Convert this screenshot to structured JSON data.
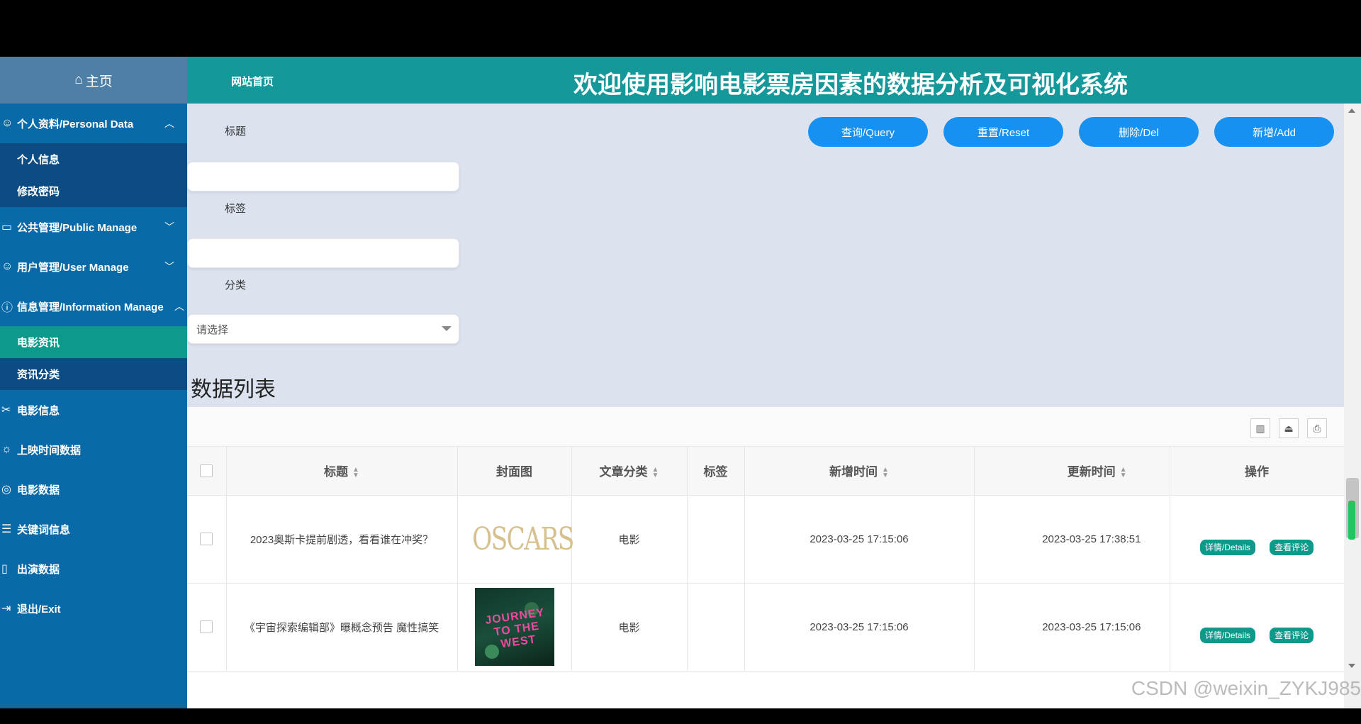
{
  "sidebar": {
    "home": "主页",
    "groups": [
      {
        "label": "个人资料/Personal Data",
        "icon": "user-icon",
        "expanded": true,
        "items": [
          "个人信息",
          "修改密码"
        ]
      },
      {
        "label": "公共管理/Public Manage",
        "icon": "monitor-icon",
        "expanded": false,
        "items": []
      },
      {
        "label": "用户管理/User Manage",
        "icon": "user-icon",
        "expanded": false,
        "items": []
      },
      {
        "label": "信息管理/Information Manage",
        "icon": "info-icon",
        "expanded": true,
        "items": [
          "电影资讯",
          "资讯分类"
        ],
        "active_item": "电影资讯"
      },
      {
        "label": "电影信息",
        "icon": "film-icon"
      },
      {
        "label": "上映时间数据",
        "icon": "calendar-icon"
      },
      {
        "label": "电影数据",
        "icon": "data-icon"
      },
      {
        "label": "关键词信息",
        "icon": "keyword-icon"
      },
      {
        "label": "出演数据",
        "icon": "phone-icon"
      },
      {
        "label": "退出/Exit",
        "icon": "exit-icon"
      }
    ]
  },
  "header": {
    "nav_home": "网站首页",
    "title": "欢迎使用影响电影票房因素的数据分析及可视化系统"
  },
  "filters": {
    "title_label": "标题",
    "tag_label": "标签",
    "category_label": "分类",
    "category_placeholder": "请选择"
  },
  "buttons": {
    "query": "查询/Query",
    "reset": "重置/Reset",
    "delete": "删除/Del",
    "add": "新增/Add"
  },
  "section_title": "数据列表",
  "table": {
    "columns": [
      "标题",
      "封面图",
      "文章分类",
      "标签",
      "新增时间",
      "更新时间",
      "操作"
    ],
    "rows": [
      {
        "title": "2023奥斯卡提前剧透，看看谁在冲奖？",
        "cover": "OSCARS",
        "category": "电影",
        "tag": "",
        "created": "2023-03-25 17:15:06",
        "updated": "2023-03-25 17:38:51"
      },
      {
        "title": "《宇宙探索编辑部》曝概念预告 魔性搞笑",
        "cover": "JOURNEY TO THE WEST",
        "category": "电影",
        "tag": "",
        "created": "2023-03-25 17:15:06",
        "updated": "2023-03-25 17:15:06"
      }
    ],
    "row_actions": [
      "详情/Details",
      "查看评论"
    ]
  },
  "watermark": "CSDN @weixin_ZYKJ985",
  "colors": {
    "sidebar": "#0a6aa8",
    "header": "#14989a",
    "accent_button": "#1691f2",
    "active_item": "#0e9a8a"
  }
}
